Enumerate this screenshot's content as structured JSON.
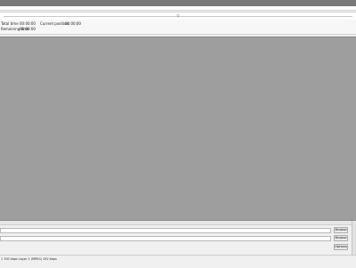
{
  "seek": {
    "marker": "▽"
  },
  "info": {
    "total_label": "Total time",
    "total_value": "00:00:00",
    "remaining_label": "Remaining time",
    "remaining_value": "00:00:00",
    "position_label": "Current position",
    "position_value": "00:00:00"
  },
  "controls": {
    "button1": "Browse",
    "button2": "Browse",
    "button3": "Options"
  },
  "status": {
    "text": "1 700 kbps    Layer 1 (MPEG) 192 kbps"
  }
}
